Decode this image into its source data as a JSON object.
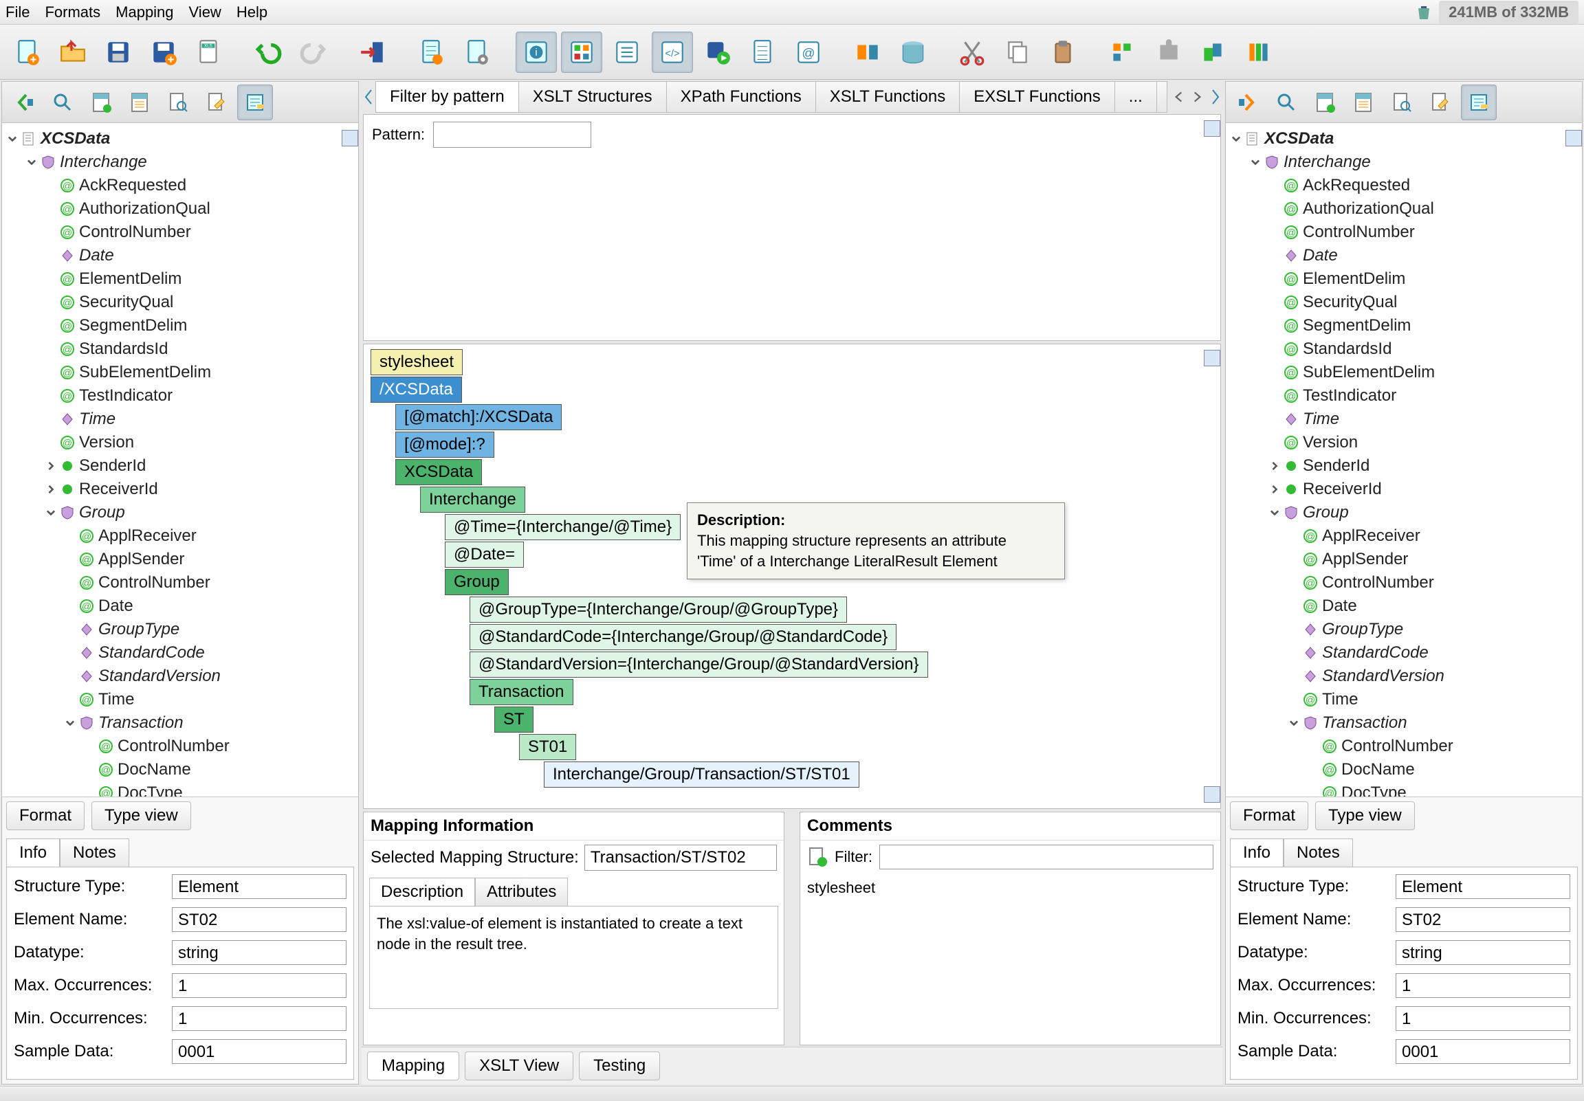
{
  "menu": [
    "File",
    "Formats",
    "Mapping",
    "View",
    "Help"
  ],
  "memory": "241MB of 332MB",
  "center_tabs": [
    "Filter by pattern",
    "XSLT Structures",
    "XPath Functions",
    "XSLT Functions",
    "EXSLT Functions",
    "..."
  ],
  "pattern_label": "Pattern:",
  "side_tabs": [
    "Format",
    "Type view"
  ],
  "info_tabs": [
    "Info",
    "Notes"
  ],
  "info": {
    "structure_type_label": "Structure Type:",
    "structure_type": "Element",
    "element_name_label": "Element Name:",
    "element_name": "ST02",
    "datatype_label": "Datatype:",
    "datatype": "string",
    "max_occ_label": "Max. Occurrences:",
    "max_occ": "1",
    "min_occ_label": "Min. Occurrences:",
    "min_occ": "1",
    "sample_label": "Sample Data:",
    "sample": "0001"
  },
  "mapping_info": {
    "title": "Mapping Information",
    "sel_label": "Selected Mapping Structure:",
    "sel_value": "Transaction/ST/ST02",
    "desc_tabs": [
      "Description",
      "Attributes"
    ],
    "desc": "The xsl:value-of element is instantiated to create a text node in the result tree."
  },
  "comments": {
    "title": "Comments",
    "filter_label": "Filter:",
    "line": "stylesheet"
  },
  "center_bottom_tabs": [
    "Mapping",
    "XSLT View",
    "Testing"
  ],
  "tooltip": {
    "h": "Description:",
    "l1": "This mapping structure represents an attribute",
    "l2": "'Time' of a Interchange LiteralResult Element"
  },
  "mapping_nodes": {
    "stylesheet": "stylesheet",
    "xcsdata_root": "/XCSData",
    "match": "[@match]:/XCSData",
    "mode": "[@mode]:?",
    "xcsdata": "XCSData",
    "interchange": "Interchange",
    "time": "@Time={Interchange/@Time}",
    "date": "@Date=",
    "group": "Group",
    "grouptype": "@GroupType={Interchange/Group/@GroupType}",
    "stdcode": "@StandardCode={Interchange/Group/@StandardCode}",
    "stdver": "@StandardVersion={Interchange/Group/@StandardVersion}",
    "transaction": "Transaction",
    "st": "ST",
    "st01": "ST01",
    "st01_path": "Interchange/Group/Transaction/ST/ST01"
  },
  "tree_root": "XCSData",
  "tree": {
    "interchange": "Interchange",
    "ack": "AckRequested",
    "authq": "AuthorizationQual",
    "ctrl": "ControlNumber",
    "date": "Date",
    "elemd": "ElementDelim",
    "secq": "SecurityQual",
    "segd": "SegmentDelim",
    "stdsid": "StandardsId",
    "subed": "SubElementDelim",
    "testind": "TestIndicator",
    "time": "Time",
    "version": "Version",
    "senderid": "SenderId",
    "receiverid": "ReceiverId",
    "group": "Group",
    "applrecv": "ApplReceiver",
    "applsend": "ApplSender",
    "gctrl": "ControlNumber",
    "gdate": "Date",
    "grouptype": "GroupType",
    "stdcode": "StandardCode",
    "stdver": "StandardVersion",
    "gtime": "Time",
    "transaction": "Transaction",
    "tctrl": "ControlNumber",
    "docname": "DocName",
    "doctype": "DocType"
  }
}
